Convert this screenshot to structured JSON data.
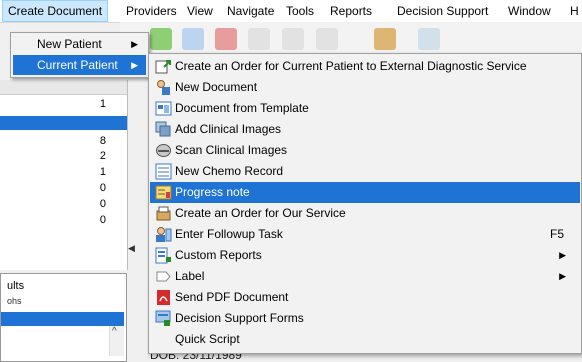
{
  "menubar": {
    "items": [
      "Create Document",
      "Providers",
      "View",
      "Navigate",
      "Tools",
      "Reports",
      "Decision Support",
      "Window",
      "H"
    ]
  },
  "menu1": {
    "items": [
      {
        "label": "New Patient",
        "arrow": "▶"
      },
      {
        "label": "Current Patient",
        "arrow": "▶"
      }
    ]
  },
  "submenu": {
    "items": [
      {
        "label": "Create an Order for Current Patient to External Diagnostic Service",
        "icon": "order-external-icon",
        "shortcut": "",
        "arrow": ""
      },
      {
        "label": "New Document",
        "icon": "new-document-icon",
        "shortcut": "",
        "arrow": ""
      },
      {
        "label": "Document from Template",
        "icon": "template-icon",
        "shortcut": "",
        "arrow": ""
      },
      {
        "label": "Add Clinical Images",
        "icon": "add-images-icon",
        "shortcut": "",
        "arrow": ""
      },
      {
        "label": "Scan Clinical Images",
        "icon": "scanner-icon",
        "shortcut": "",
        "arrow": ""
      },
      {
        "label": "New Chemo Record",
        "icon": "chemo-record-icon",
        "shortcut": "",
        "arrow": ""
      },
      {
        "label": "Progress note",
        "icon": "progress-note-icon",
        "shortcut": "",
        "arrow": ""
      },
      {
        "label": "Create an Order for Our Service",
        "icon": "order-service-icon",
        "shortcut": "",
        "arrow": ""
      },
      {
        "label": "Enter Followup Task",
        "icon": "followup-task-icon",
        "shortcut": "F5",
        "arrow": ""
      },
      {
        "label": "Custom Reports",
        "icon": "custom-reports-icon",
        "shortcut": "",
        "arrow": "▶"
      },
      {
        "label": "Label",
        "icon": "label-icon",
        "shortcut": "",
        "arrow": "▶"
      },
      {
        "label": "Send PDF Document",
        "icon": "pdf-icon",
        "shortcut": "",
        "arrow": ""
      },
      {
        "label": "Decision Support Forms",
        "icon": "decision-forms-icon",
        "shortcut": "",
        "arrow": ""
      },
      {
        "label": "Quick Script",
        "icon": "",
        "shortcut": "",
        "arrow": ""
      }
    ]
  },
  "leftpane": {
    "numbers": [
      "1",
      "8",
      "2",
      "1",
      "0",
      "0",
      "0"
    ]
  },
  "bottompane": {
    "tab_label": "ults",
    "sub_tab": "ohs",
    "scroll_arrow": "^"
  },
  "splitter_arrow": "◀",
  "dob_text": "DOB: 23/11/1989"
}
